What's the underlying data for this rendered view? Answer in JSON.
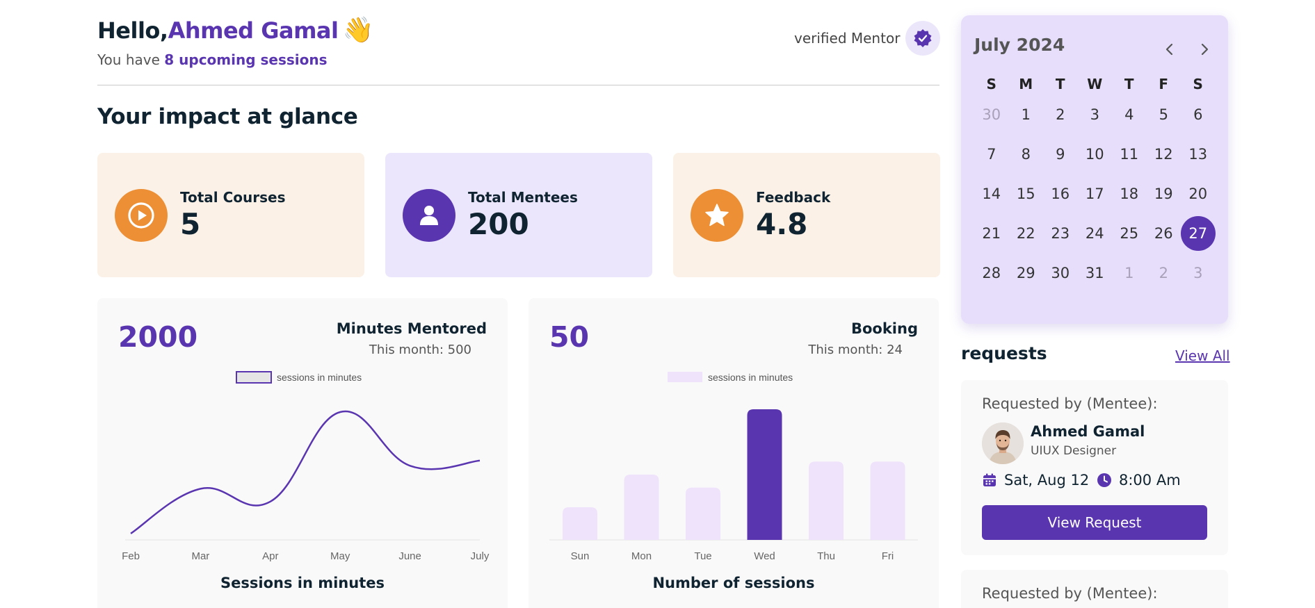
{
  "header": {
    "greeting_prefix": "Hello,",
    "user_name": "Ahmed Gamal",
    "wave_emoji": "👋",
    "subline_prefix": "You have ",
    "subline_highlight": "8 upcoming sessions",
    "verified_label": "verified Mentor"
  },
  "impact": {
    "title": "Your impact at glance",
    "cards": [
      {
        "label": "Total Courses",
        "value": "5",
        "icon": "play-circle-icon"
      },
      {
        "label": "Total Mentees",
        "value": "200",
        "icon": "user-icon"
      },
      {
        "label": "Feedback",
        "value": "4.8",
        "icon": "star-icon"
      }
    ]
  },
  "minutes_card": {
    "big_value": "2000",
    "title": "Minutes Mentored",
    "subtitle": "This month: 500",
    "caption": "Sessions in minutes"
  },
  "booking_card": {
    "big_value": "50",
    "title": "Booking",
    "subtitle": "This month: 24",
    "caption": "Number of sessions"
  },
  "chart_data": [
    {
      "type": "line",
      "categories": [
        "Feb",
        "Mar",
        "Apr",
        "May",
        "June",
        "July"
      ],
      "series": [
        {
          "name": "sessions in minutes",
          "values": [
            5,
            40,
            30,
            100,
            58,
            62
          ]
        }
      ],
      "title": "Sessions in minutes",
      "ylim": [
        0,
        100
      ],
      "legend": "top",
      "grid": false,
      "color": "#5a35b0"
    },
    {
      "type": "bar",
      "categories": [
        "Sun",
        "Mon",
        "Tue",
        "Wed",
        "Thu",
        "Fri"
      ],
      "series": [
        {
          "name": "sessions in minutes",
          "values": [
            25,
            50,
            40,
            100,
            60,
            60
          ]
        }
      ],
      "title": "Number of sessions",
      "ylim": [
        0,
        100
      ],
      "legend": "top",
      "grid": false,
      "highlight_category": "Wed",
      "color": "#efe3fb",
      "highlight_color": "#5a35b0"
    }
  ],
  "calendar": {
    "month_label": "July 2024",
    "weekdays": [
      "S",
      "M",
      "T",
      "W",
      "T",
      "F",
      "S"
    ],
    "weeks": [
      [
        {
          "d": "30",
          "muted": true
        },
        {
          "d": "1"
        },
        {
          "d": "2"
        },
        {
          "d": "3"
        },
        {
          "d": "4"
        },
        {
          "d": "5"
        },
        {
          "d": "6"
        }
      ],
      [
        {
          "d": "7"
        },
        {
          "d": "8"
        },
        {
          "d": "9"
        },
        {
          "d": "10"
        },
        {
          "d": "11"
        },
        {
          "d": "12"
        },
        {
          "d": "13"
        }
      ],
      [
        {
          "d": "14"
        },
        {
          "d": "15"
        },
        {
          "d": "16"
        },
        {
          "d": "17"
        },
        {
          "d": "18"
        },
        {
          "d": "19"
        },
        {
          "d": "20"
        }
      ],
      [
        {
          "d": "21"
        },
        {
          "d": "22"
        },
        {
          "d": "23"
        },
        {
          "d": "24"
        },
        {
          "d": "25"
        },
        {
          "d": "26"
        },
        {
          "d": "27",
          "selected": true
        }
      ],
      [
        {
          "d": "28"
        },
        {
          "d": "29"
        },
        {
          "d": "30"
        },
        {
          "d": "31"
        },
        {
          "d": "1",
          "muted": true
        },
        {
          "d": "2",
          "muted": true
        },
        {
          "d": "3",
          "muted": true
        }
      ]
    ]
  },
  "requests": {
    "title": "requests",
    "view_all": "View All",
    "items": [
      {
        "label": "Requested by (Mentee):",
        "name": "Ahmed Gamal",
        "role": "UIUX Designer",
        "date": "Sat, Aug 12",
        "time": "8:00 Am",
        "button": "View Request"
      },
      {
        "label": "Requested by (Mentee):"
      }
    ]
  },
  "colors": {
    "brand": "#5a35b0",
    "orange": "#ec8f35",
    "card_orange_bg": "#fbf1e7",
    "card_purple_bg": "#ebe6fb",
    "calendar_bg": "#e6defb",
    "bar_light": "#efe3fb"
  }
}
